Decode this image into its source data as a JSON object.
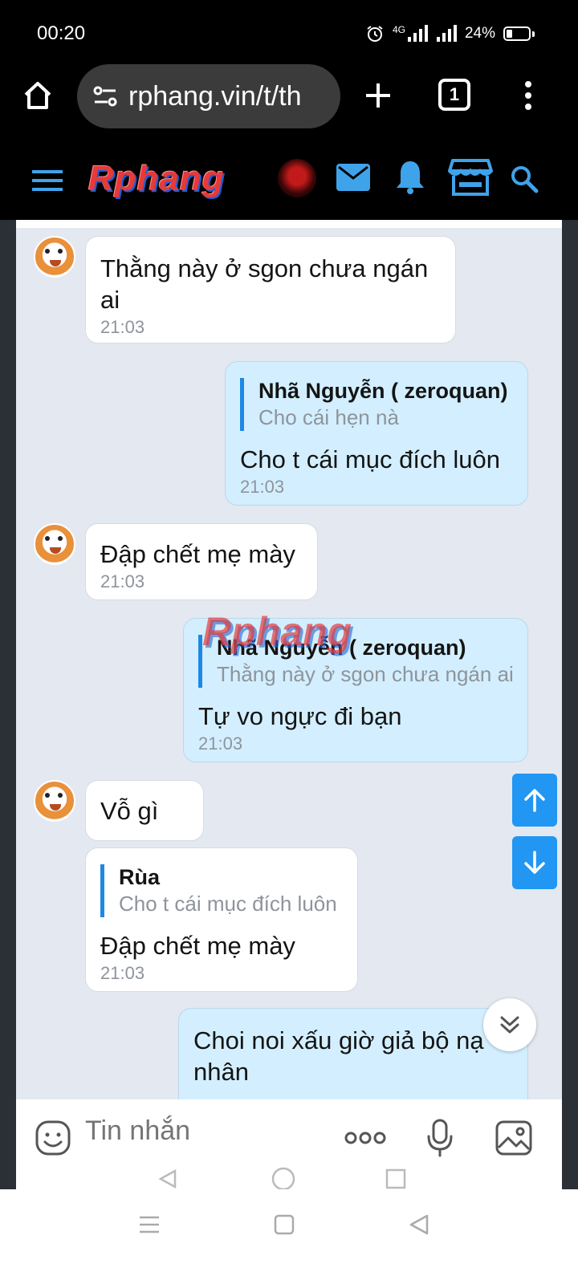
{
  "status_bar": {
    "time": "00:20",
    "network": "4G",
    "battery": "24%"
  },
  "browser": {
    "url": "rphang.vin/t/th",
    "tab_count": "1"
  },
  "site": {
    "logo": "Rphang",
    "watermark": "Rphang"
  },
  "messages": [
    {
      "side": "in",
      "text": "Thằng này ở sgon chưa ngán ai",
      "time": "21:03"
    },
    {
      "side": "out",
      "quote_name": "Nhã Nguyễn ( zeroquan)",
      "quote_text": "Cho cái hẹn nà",
      "text": "Cho t cái mục đích luôn",
      "time": "21:03"
    },
    {
      "side": "in",
      "text": "Đập chết mẹ mày",
      "time": "21:03"
    },
    {
      "side": "out",
      "quote_name": "Nhã Nguyễn ( zeroquan)",
      "quote_text": "Thằng này ở sgon chưa ngán ai",
      "text": "Tự vo ngực đi bạn",
      "time": "21:03"
    },
    {
      "side": "in",
      "text": "Vỗ gì"
    },
    {
      "side": "in",
      "quote_name": "Rùa",
      "quote_text": "Cho t cái mục đích luôn",
      "text": "Đập chết mẹ mày",
      "time": "21:03"
    },
    {
      "side": "out",
      "text": "Choi noi xấu giờ giả bộ nạ nhân"
    }
  ],
  "composer": {
    "placeholder": "Tin nhắn"
  },
  "colors": {
    "accent": "#2196f3",
    "chat_bg": "#e3e8f1",
    "out_bubble": "#d3efff",
    "in_bubble": "#ffffff"
  }
}
